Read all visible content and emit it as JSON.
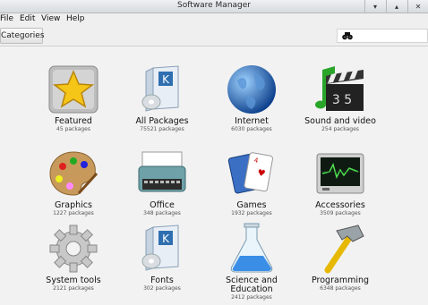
{
  "window": {
    "title": "Software Manager",
    "buttons": {
      "menu": "▾",
      "maximize": "▴",
      "close": "✕"
    }
  },
  "menu": {
    "file": "File",
    "edit": "Edit",
    "view": "View",
    "help": "Help"
  },
  "toolbar": {
    "categories_label": "Categories",
    "search_icon": "binoculars-icon"
  },
  "categories": [
    {
      "label": "Featured",
      "count": "45 packages",
      "icon": "star-icon"
    },
    {
      "label": "All Packages",
      "count": "75521 packages",
      "icon": "package-box-icon"
    },
    {
      "label": "Internet",
      "count": "6030 packages",
      "icon": "globe-icon"
    },
    {
      "label": "Sound and video",
      "count": "254 packages",
      "icon": "music-clapperboard-icon"
    },
    {
      "label": "Graphics",
      "count": "1227 packages",
      "icon": "paint-palette-icon"
    },
    {
      "label": "Office",
      "count": "348 packages",
      "icon": "typewriter-icon"
    },
    {
      "label": "Games",
      "count": "1932 packages",
      "icon": "playing-cards-icon"
    },
    {
      "label": "Accessories",
      "count": "3509 packages",
      "icon": "oscilloscope-icon"
    },
    {
      "label": "System tools",
      "count": "2121 packages",
      "icon": "gear-icon"
    },
    {
      "label": "Fonts",
      "count": "302 packages",
      "icon": "font-package-icon"
    },
    {
      "label": "Science and Education",
      "count": "2412 packages",
      "icon": "flask-icon"
    },
    {
      "label": "Programming",
      "count": "6348 packages",
      "icon": "hammer-icon"
    }
  ]
}
